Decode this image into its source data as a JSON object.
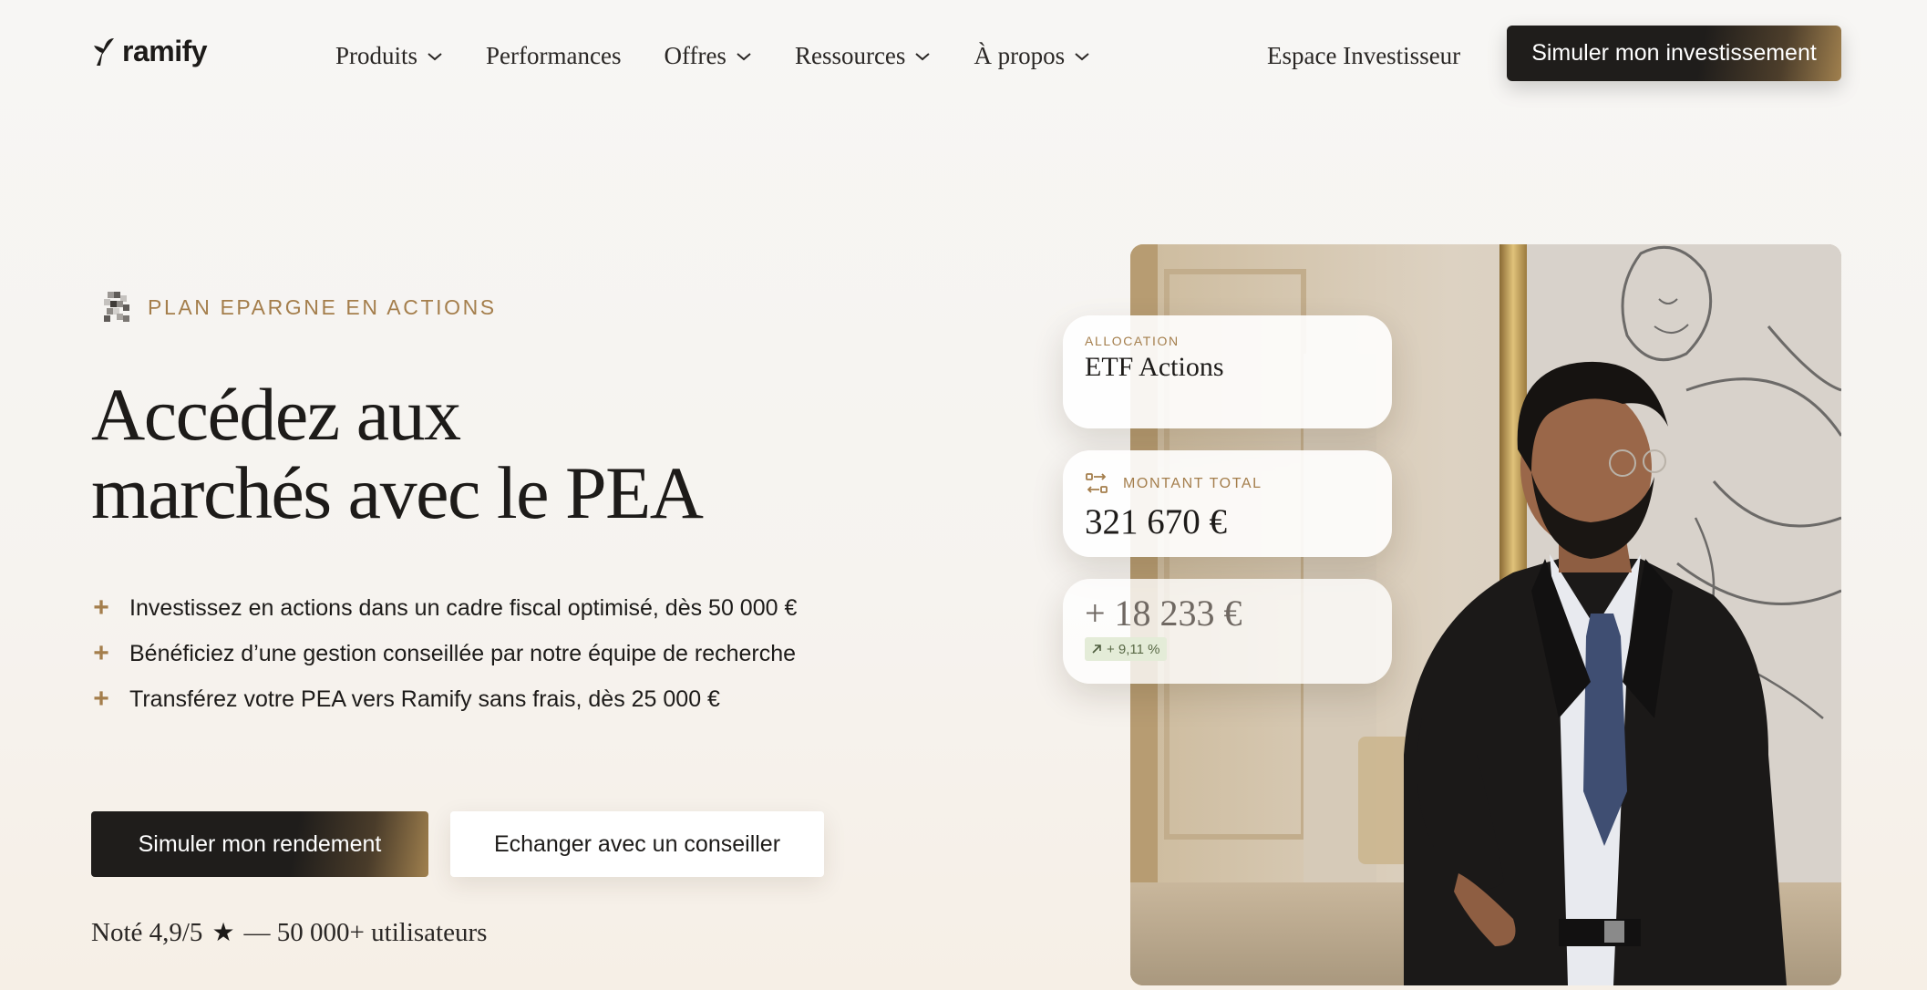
{
  "nav": {
    "logo_text": "ramify",
    "menu": [
      {
        "label": "Produits",
        "has_dropdown": true
      },
      {
        "label": "Performances",
        "has_dropdown": false
      },
      {
        "label": "Offres",
        "has_dropdown": true
      },
      {
        "label": "Ressources",
        "has_dropdown": true
      },
      {
        "label": "À propos",
        "has_dropdown": true
      }
    ],
    "espace_label": "Espace Investisseur",
    "cta_label": "Simuler mon investissement"
  },
  "hero": {
    "eyebrow": "PLAN EPARGNE EN ACTIONS",
    "headline_line1": "Accédez aux",
    "headline_line2": "marchés avec le PEA",
    "bullets": [
      "Investissez en actions dans un cadre fiscal optimisé, dès 50 000 €",
      "Bénéficiez d’une gestion conseillée par notre équipe de recherche",
      "Transférez votre PEA vers Ramify sans frais, dès 25 000 €"
    ],
    "bullet_icon": "plus-icon",
    "primary_button": "Simuler mon rendement",
    "secondary_button": "Echanger avec un conseiller",
    "rating_prefix": "Noté 4,9/5",
    "rating_star": "★",
    "rating_suffix": "— 50 000+ utilisateurs"
  },
  "cards": {
    "allocation_label": "ALLOCATION",
    "allocation_value": "ETF Actions",
    "total_label": "MONTANT TOTAL",
    "total_value": "321 670 €",
    "gain_value": "+ 18 233 €",
    "gain_percent": "+ 9,11 %"
  },
  "colors": {
    "accent": "#a47e4c",
    "dark": "#1f1d1b",
    "background": "#f6f3ef",
    "gain_badge_bg": "#e4ecd8"
  }
}
